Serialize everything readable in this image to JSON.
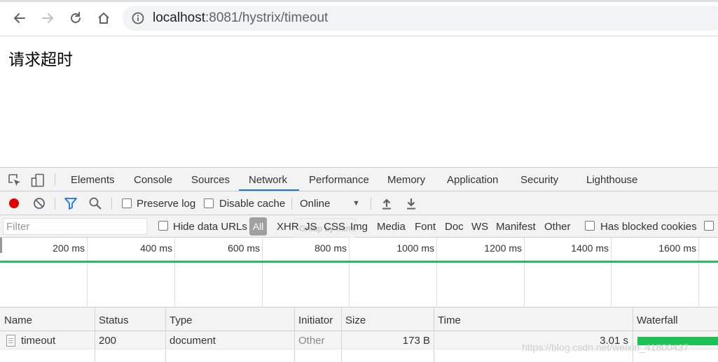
{
  "browser": {
    "url_host": "localhost",
    "url_path": ":8081/hystrix/timeout"
  },
  "page": {
    "text": "请求超时"
  },
  "devtools": {
    "tabs": [
      "Elements",
      "Console",
      "Sources",
      "Network",
      "Performance",
      "Memory",
      "Application",
      "Security",
      "Lighthouse"
    ],
    "active_tab": "Network",
    "toolbar": {
      "preserve_log": "Preserve log",
      "disable_cache": "Disable cache",
      "throttling": "Online"
    },
    "filter": {
      "placeholder": "Filter",
      "hide_data_urls": "Hide data URLs",
      "all": "All",
      "types": [
        "XHR",
        "JS",
        "CSS",
        "Img",
        "Media",
        "Font",
        "Doc",
        "WS",
        "Manifest",
        "Other"
      ],
      "has_blocked_cookies": "Has blocked cookies",
      "ghost_text": "Group by frame"
    },
    "overview": {
      "ticks": [
        "200 ms",
        "400 ms",
        "600 ms",
        "800 ms",
        "1000 ms",
        "1200 ms",
        "1400 ms",
        "1600 ms"
      ]
    },
    "table": {
      "headers": {
        "name": "Name",
        "status": "Status",
        "type": "Type",
        "initiator": "Initiator",
        "size": "Size",
        "time": "Time",
        "waterfall": "Waterfall"
      },
      "rows": [
        {
          "name": "timeout",
          "status": "200",
          "type": "document",
          "initiator": "Other",
          "size": "173 B",
          "time": "3.01 s"
        }
      ]
    },
    "watermark": "https://blog.csdn.net/weixin_41800437"
  },
  "colors": {
    "record": "#e00000",
    "accent": "#1a73e8",
    "waterfall": "#1dc156"
  }
}
